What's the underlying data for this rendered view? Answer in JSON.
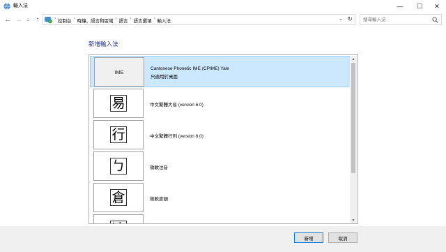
{
  "window": {
    "title": "輸入法",
    "minimize_glyph": "—",
    "maximize_glyph": "☐",
    "close_glyph": "✕"
  },
  "nav": {
    "back_glyph": "←",
    "forward_glyph": "→",
    "recent_glyph": "⌄",
    "up_glyph": "↑",
    "breadcrumbs": [
      "控制台",
      "時鐘、語言和區域",
      "語言",
      "語言選項",
      "輸入法"
    ],
    "separator": "›",
    "dropdown_glyph": "⌄",
    "refresh_glyph": "↻",
    "search_placeholder": "搜尋輸入法"
  },
  "main": {
    "heading": "新增輸入法",
    "items": [
      {
        "tile": "IME",
        "name": "Cantonese Phonetic IME (CPIME) Yale",
        "sub": "只適用於桌面",
        "selected": true
      },
      {
        "tile": "易",
        "name": "中文繁體大易 (version 6.0)",
        "sub": ""
      },
      {
        "tile": "行",
        "name": "中文繁體行列 (version 6.0)",
        "sub": ""
      },
      {
        "tile": "ㄅ",
        "name": "微軟注音",
        "sub": ""
      },
      {
        "tile": "倉",
        "name": "微軟倉頡",
        "sub": ""
      },
      {
        "tile": "速",
        "name": "",
        "sub": ""
      }
    ],
    "scroll_up_glyph": "▲",
    "scroll_down_glyph": "▼"
  },
  "footer": {
    "add_label": "新增",
    "cancel_label": "取消"
  },
  "colors": {
    "selection_bg": "#cce8ff",
    "selection_border": "#99d1ff",
    "heading": "#1e3287",
    "footer_bg": "#f0f0f0"
  }
}
